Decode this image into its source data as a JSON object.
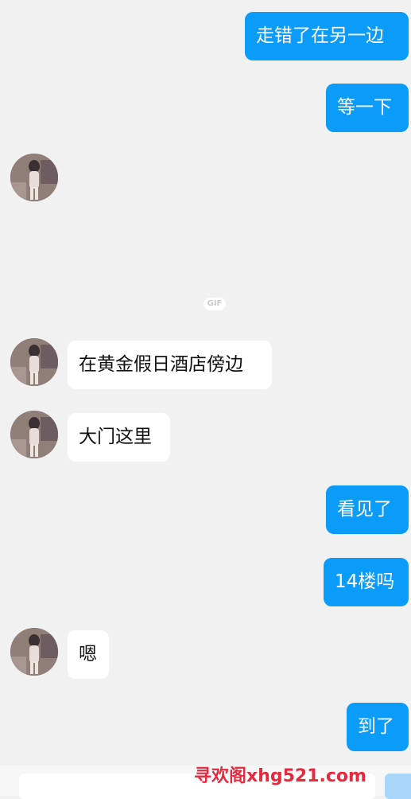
{
  "messages": [
    {
      "text": "走错了在另一边"
    },
    {
      "text": "等一下"
    },
    {
      "text": ""
    },
    {
      "text": "在黄金假日酒店傍边"
    },
    {
      "text": "大门这里"
    },
    {
      "text": "看见了"
    },
    {
      "text": "14楼吗"
    },
    {
      "text": "嗯"
    },
    {
      "text": "到了"
    }
  ],
  "gif_badge": "GIF",
  "watermark": "寻欢阁xhg521.com",
  "colors": {
    "outgoing_bubble": "#0b9bf8",
    "incoming_bubble": "#ffffff",
    "background": "#f1f1f1",
    "watermark": "#e8283c"
  }
}
